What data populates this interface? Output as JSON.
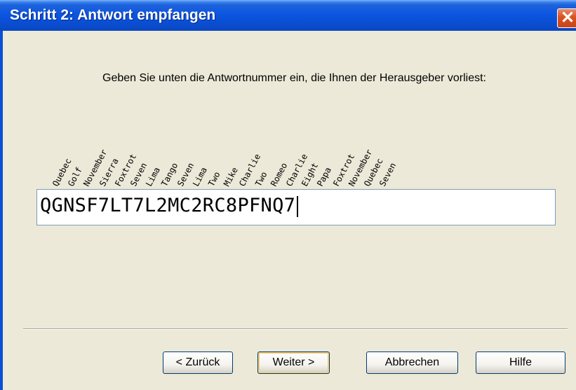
{
  "window": {
    "title": "Schritt 2: Antwort empfangen",
    "close_label": "✕"
  },
  "instruction": "Geben Sie unten die Antwortnummer ein, die Ihnen der Herausgeber vorliest:",
  "phonetic_words": [
    "Quebec",
    "Golf",
    "November",
    "Sierra",
    "Foxtrot",
    "Seven",
    "Lima",
    "Tango",
    "Seven",
    "Lima",
    "Two",
    "Mike",
    "Charlie",
    "Two",
    "Romeo",
    "Charlie",
    "Eight",
    "Papa",
    "Foxtrot",
    "November",
    "Quebec",
    "Seven"
  ],
  "answer": {
    "value": "QGNSF7LT7L2MC2RC8PFNQ7"
  },
  "buttons": {
    "back": "< Zurück",
    "next": "Weiter >",
    "cancel": "Abbrechen",
    "help": "Hilfe"
  }
}
